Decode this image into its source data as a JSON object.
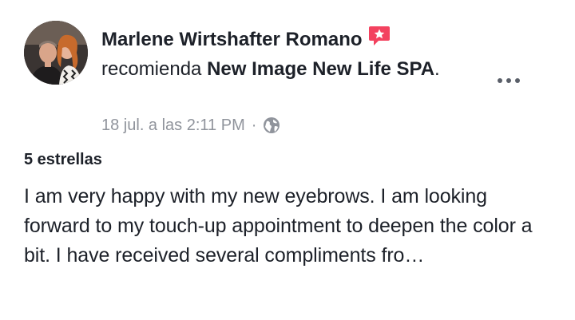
{
  "post": {
    "author_name": "Marlene Wirtshafter Romano",
    "action_text": "recomienda",
    "page_name": "New Image New Life SPA",
    "period": ".",
    "timestamp": "18 jul. a las 2:11 PM",
    "separator": "·",
    "privacy_icon": "globe-icon",
    "recommendation_icon": "recommendation-star-icon",
    "more_icon": "more-options-icon",
    "rating_label": "5 estrellas",
    "review_text": "I am very happy with my new eyebrows. I am looking forward to my touch-up appointment to deepen the color a bit. I have received several compliments fro…"
  },
  "colors": {
    "text_primary": "#1d2129",
    "text_secondary": "#90949c",
    "badge_red": "#f3425f",
    "icon_gray": "#5a5f69"
  }
}
